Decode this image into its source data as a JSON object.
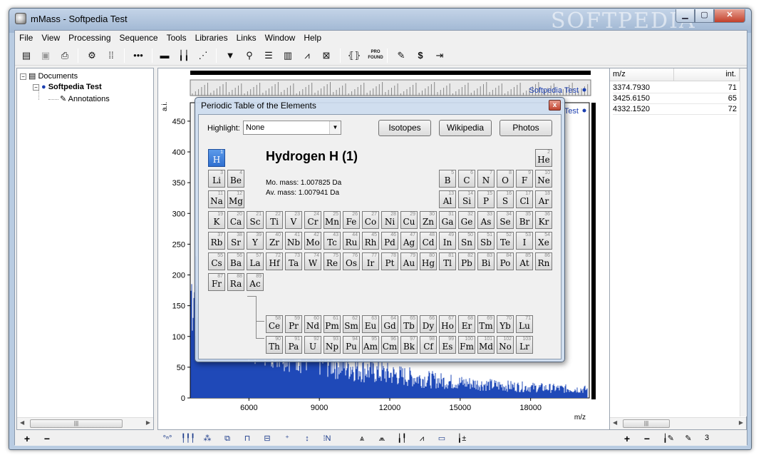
{
  "window": {
    "title": "mMass - Softpedia Test",
    "watermark": "SOFTPEDIA"
  },
  "menu": [
    "File",
    "View",
    "Processing",
    "Sequence",
    "Tools",
    "Libraries",
    "Links",
    "Window",
    "Help"
  ],
  "toolbar_icons": [
    "open-document-icon",
    "save-icon",
    "print-icon",
    "processing-icon",
    "calibration-icon",
    "sequence-icon",
    "spectrum-baseline-icon",
    "peak-list-icon",
    "deisotope-icon",
    "filter-icon",
    "mass-calculator-icon",
    "compare-peaks-icon",
    "compounds-icon",
    "envelope-fit-icon",
    "mass-defect-icon",
    "mass-to-formula-icon",
    "pro-found-icon",
    "report-icon",
    "currency-icon",
    "export-icon"
  ],
  "toolbar_text": {
    "pro_found": "PRO\nFOUND",
    "dollar": "$"
  },
  "tree": {
    "root": "Documents",
    "document": "Softpedia Test",
    "annotations": "Annotations"
  },
  "plot": {
    "legend1": "Softpedia Test",
    "legend2": "Test",
    "y_axis_label": "a.i.",
    "x_axis_label": "m/z",
    "y_ticks": [
      "450",
      "400",
      "350",
      "300",
      "250",
      "200",
      "150",
      "100",
      "50",
      "0"
    ],
    "x_ticks": [
      "6000",
      "9000",
      "12000",
      "15000",
      "18000"
    ],
    "overlay_text": "SOFTPEDIA"
  },
  "chart_data": {
    "type": "line",
    "xlabel": "m/z",
    "ylabel": "a.i.",
    "ylim": [
      0,
      480
    ],
    "xlim": [
      3500,
      20500
    ],
    "series": [
      {
        "name": "Softpedia Test"
      }
    ]
  },
  "peak_table": {
    "columns": [
      "m/z",
      "int."
    ],
    "rows": [
      {
        "mz": "3374.7930",
        "int": "71"
      },
      {
        "mz": "3425.6150",
        "int": "65"
      },
      {
        "mz": "4332.1520",
        "int": "72"
      }
    ]
  },
  "status": {
    "count": "3",
    "plus": "+",
    "minus": "−"
  },
  "dialog": {
    "title": "Periodic Table of the Elements",
    "highlight_label": "Highlight:",
    "highlight_value": "None",
    "buttons": [
      "Isotopes",
      "Wikipedia",
      "Photos"
    ],
    "element_name": "Hydrogen H (1)",
    "mo_mass": "Mo. mass: 1.007825 Da",
    "av_mass": "Av. mass: 1.007941 Da",
    "selected": 1,
    "elements": [
      [
        "H",
        1,
        1,
        1
      ],
      [
        "He",
        2,
        18,
        1
      ],
      [
        "Li",
        3,
        1,
        2
      ],
      [
        "Be",
        4,
        2,
        2
      ],
      [
        "B",
        5,
        13,
        2
      ],
      [
        "C",
        6,
        14,
        2
      ],
      [
        "N",
        7,
        15,
        2
      ],
      [
        "O",
        8,
        16,
        2
      ],
      [
        "F",
        9,
        17,
        2
      ],
      [
        "Ne",
        10,
        18,
        2
      ],
      [
        "Na",
        11,
        1,
        3
      ],
      [
        "Mg",
        12,
        2,
        3
      ],
      [
        "Al",
        13,
        13,
        3
      ],
      [
        "Si",
        14,
        14,
        3
      ],
      [
        "P",
        15,
        15,
        3
      ],
      [
        "S",
        16,
        16,
        3
      ],
      [
        "Cl",
        17,
        17,
        3
      ],
      [
        "Ar",
        18,
        18,
        3
      ],
      [
        "K",
        19,
        1,
        4
      ],
      [
        "Ca",
        20,
        2,
        4
      ],
      [
        "Sc",
        21,
        3,
        4
      ],
      [
        "Ti",
        22,
        4,
        4
      ],
      [
        "V",
        23,
        5,
        4
      ],
      [
        "Cr",
        24,
        6,
        4
      ],
      [
        "Mn",
        25,
        7,
        4
      ],
      [
        "Fe",
        26,
        8,
        4
      ],
      [
        "Co",
        27,
        9,
        4
      ],
      [
        "Ni",
        28,
        10,
        4
      ],
      [
        "Cu",
        29,
        11,
        4
      ],
      [
        "Zn",
        30,
        12,
        4
      ],
      [
        "Ga",
        31,
        13,
        4
      ],
      [
        "Ge",
        32,
        14,
        4
      ],
      [
        "As",
        33,
        15,
        4
      ],
      [
        "Se",
        34,
        16,
        4
      ],
      [
        "Br",
        35,
        17,
        4
      ],
      [
        "Kr",
        36,
        18,
        4
      ],
      [
        "Rb",
        37,
        1,
        5
      ],
      [
        "Sr",
        38,
        2,
        5
      ],
      [
        "Y",
        39,
        3,
        5
      ],
      [
        "Zr",
        40,
        4,
        5
      ],
      [
        "Nb",
        41,
        5,
        5
      ],
      [
        "Mo",
        42,
        6,
        5
      ],
      [
        "Tc",
        43,
        7,
        5
      ],
      [
        "Ru",
        44,
        8,
        5
      ],
      [
        "Rh",
        45,
        9,
        5
      ],
      [
        "Pd",
        46,
        10,
        5
      ],
      [
        "Ag",
        47,
        11,
        5
      ],
      [
        "Cd",
        48,
        12,
        5
      ],
      [
        "In",
        49,
        13,
        5
      ],
      [
        "Sn",
        50,
        14,
        5
      ],
      [
        "Sb",
        51,
        15,
        5
      ],
      [
        "Te",
        52,
        16,
        5
      ],
      [
        "I",
        53,
        17,
        5
      ],
      [
        "Xe",
        54,
        18,
        5
      ],
      [
        "Cs",
        55,
        1,
        6
      ],
      [
        "Ba",
        56,
        2,
        6
      ],
      [
        "La",
        57,
        3,
        6
      ],
      [
        "Hf",
        72,
        4,
        6
      ],
      [
        "Ta",
        73,
        5,
        6
      ],
      [
        "W",
        74,
        6,
        6
      ],
      [
        "Re",
        75,
        7,
        6
      ],
      [
        "Os",
        76,
        8,
        6
      ],
      [
        "Ir",
        77,
        9,
        6
      ],
      [
        "Pt",
        78,
        10,
        6
      ],
      [
        "Au",
        79,
        11,
        6
      ],
      [
        "Hg",
        80,
        12,
        6
      ],
      [
        "Tl",
        81,
        13,
        6
      ],
      [
        "Pb",
        82,
        14,
        6
      ],
      [
        "Bi",
        83,
        15,
        6
      ],
      [
        "Po",
        84,
        16,
        6
      ],
      [
        "At",
        85,
        17,
        6
      ],
      [
        "Rn",
        86,
        18,
        6
      ],
      [
        "Fr",
        87,
        1,
        7
      ],
      [
        "Ra",
        88,
        2,
        7
      ],
      [
        "Ac",
        89,
        3,
        7
      ],
      [
        "Ce",
        58,
        4,
        9
      ],
      [
        "Pr",
        59,
        5,
        9
      ],
      [
        "Nd",
        60,
        6,
        9
      ],
      [
        "Pm",
        61,
        7,
        9
      ],
      [
        "Sm",
        62,
        8,
        9
      ],
      [
        "Eu",
        63,
        9,
        9
      ],
      [
        "Gd",
        64,
        10,
        9
      ],
      [
        "Tb",
        65,
        11,
        9
      ],
      [
        "Dy",
        66,
        12,
        9
      ],
      [
        "Ho",
        67,
        13,
        9
      ],
      [
        "Er",
        68,
        14,
        9
      ],
      [
        "Tm",
        69,
        15,
        9
      ],
      [
        "Yb",
        70,
        16,
        9
      ],
      [
        "Lu",
        71,
        17,
        9
      ],
      [
        "Th",
        90,
        4,
        10
      ],
      [
        "Pa",
        91,
        5,
        10
      ],
      [
        "U",
        92,
        6,
        10
      ],
      [
        "Np",
        93,
        7,
        10
      ],
      [
        "Pu",
        94,
        8,
        10
      ],
      [
        "Am",
        95,
        9,
        10
      ],
      [
        "Cm",
        96,
        10,
        10
      ],
      [
        "Bk",
        97,
        11,
        10
      ],
      [
        "Cf",
        98,
        12,
        10
      ],
      [
        "Es",
        99,
        13,
        10
      ],
      [
        "Fm",
        100,
        14,
        10
      ],
      [
        "Md",
        101,
        15,
        10
      ],
      [
        "No",
        102,
        16,
        10
      ],
      [
        "Lr",
        103,
        17,
        10
      ]
    ]
  }
}
